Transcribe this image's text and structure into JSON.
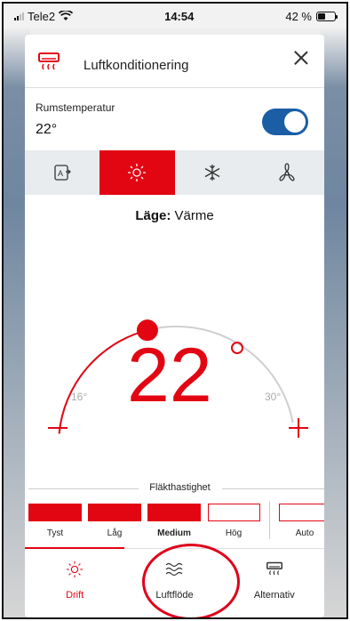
{
  "status_bar": {
    "carrier": "Tele2",
    "time": "14:54",
    "battery": "42 %",
    "battery_level": 0.42
  },
  "dialog": {
    "title": "Luftkonditionering",
    "icon": "air-conditioner-icon"
  },
  "room": {
    "label": "Rumstemperatur",
    "value": "22°",
    "power_on": true
  },
  "modes": [
    {
      "name": "auto",
      "icon": "auto-mode-icon",
      "active": false
    },
    {
      "name": "heat",
      "icon": "sun-icon",
      "active": true
    },
    {
      "name": "cool",
      "icon": "snowflake-icon",
      "active": false
    },
    {
      "name": "fan",
      "icon": "fan-icon",
      "active": false
    }
  ],
  "mode_line": {
    "label": "Läge:",
    "value": "Värme"
  },
  "temperature": {
    "setpoint": "22",
    "min_label": "16°",
    "max_label": "30°",
    "min": 16,
    "max": 30,
    "value": 22
  },
  "fan_speed": {
    "title": "Fläkthastighet",
    "levels": [
      "Tyst",
      "Låg",
      "Medium",
      "Hög",
      "Auto"
    ],
    "selected": "Medium"
  },
  "tabs": [
    {
      "label": "Drift",
      "icon": "sun-icon",
      "active": true
    },
    {
      "label": "Luftflöde",
      "icon": "airflow-icon",
      "active": false
    },
    {
      "label": "Alternativ",
      "icon": "air-conditioner-icon",
      "active": false
    }
  ],
  "colors": {
    "accent": "#e20613",
    "toggle": "#1b5ea6",
    "mode_bar": "#e9ecee"
  }
}
